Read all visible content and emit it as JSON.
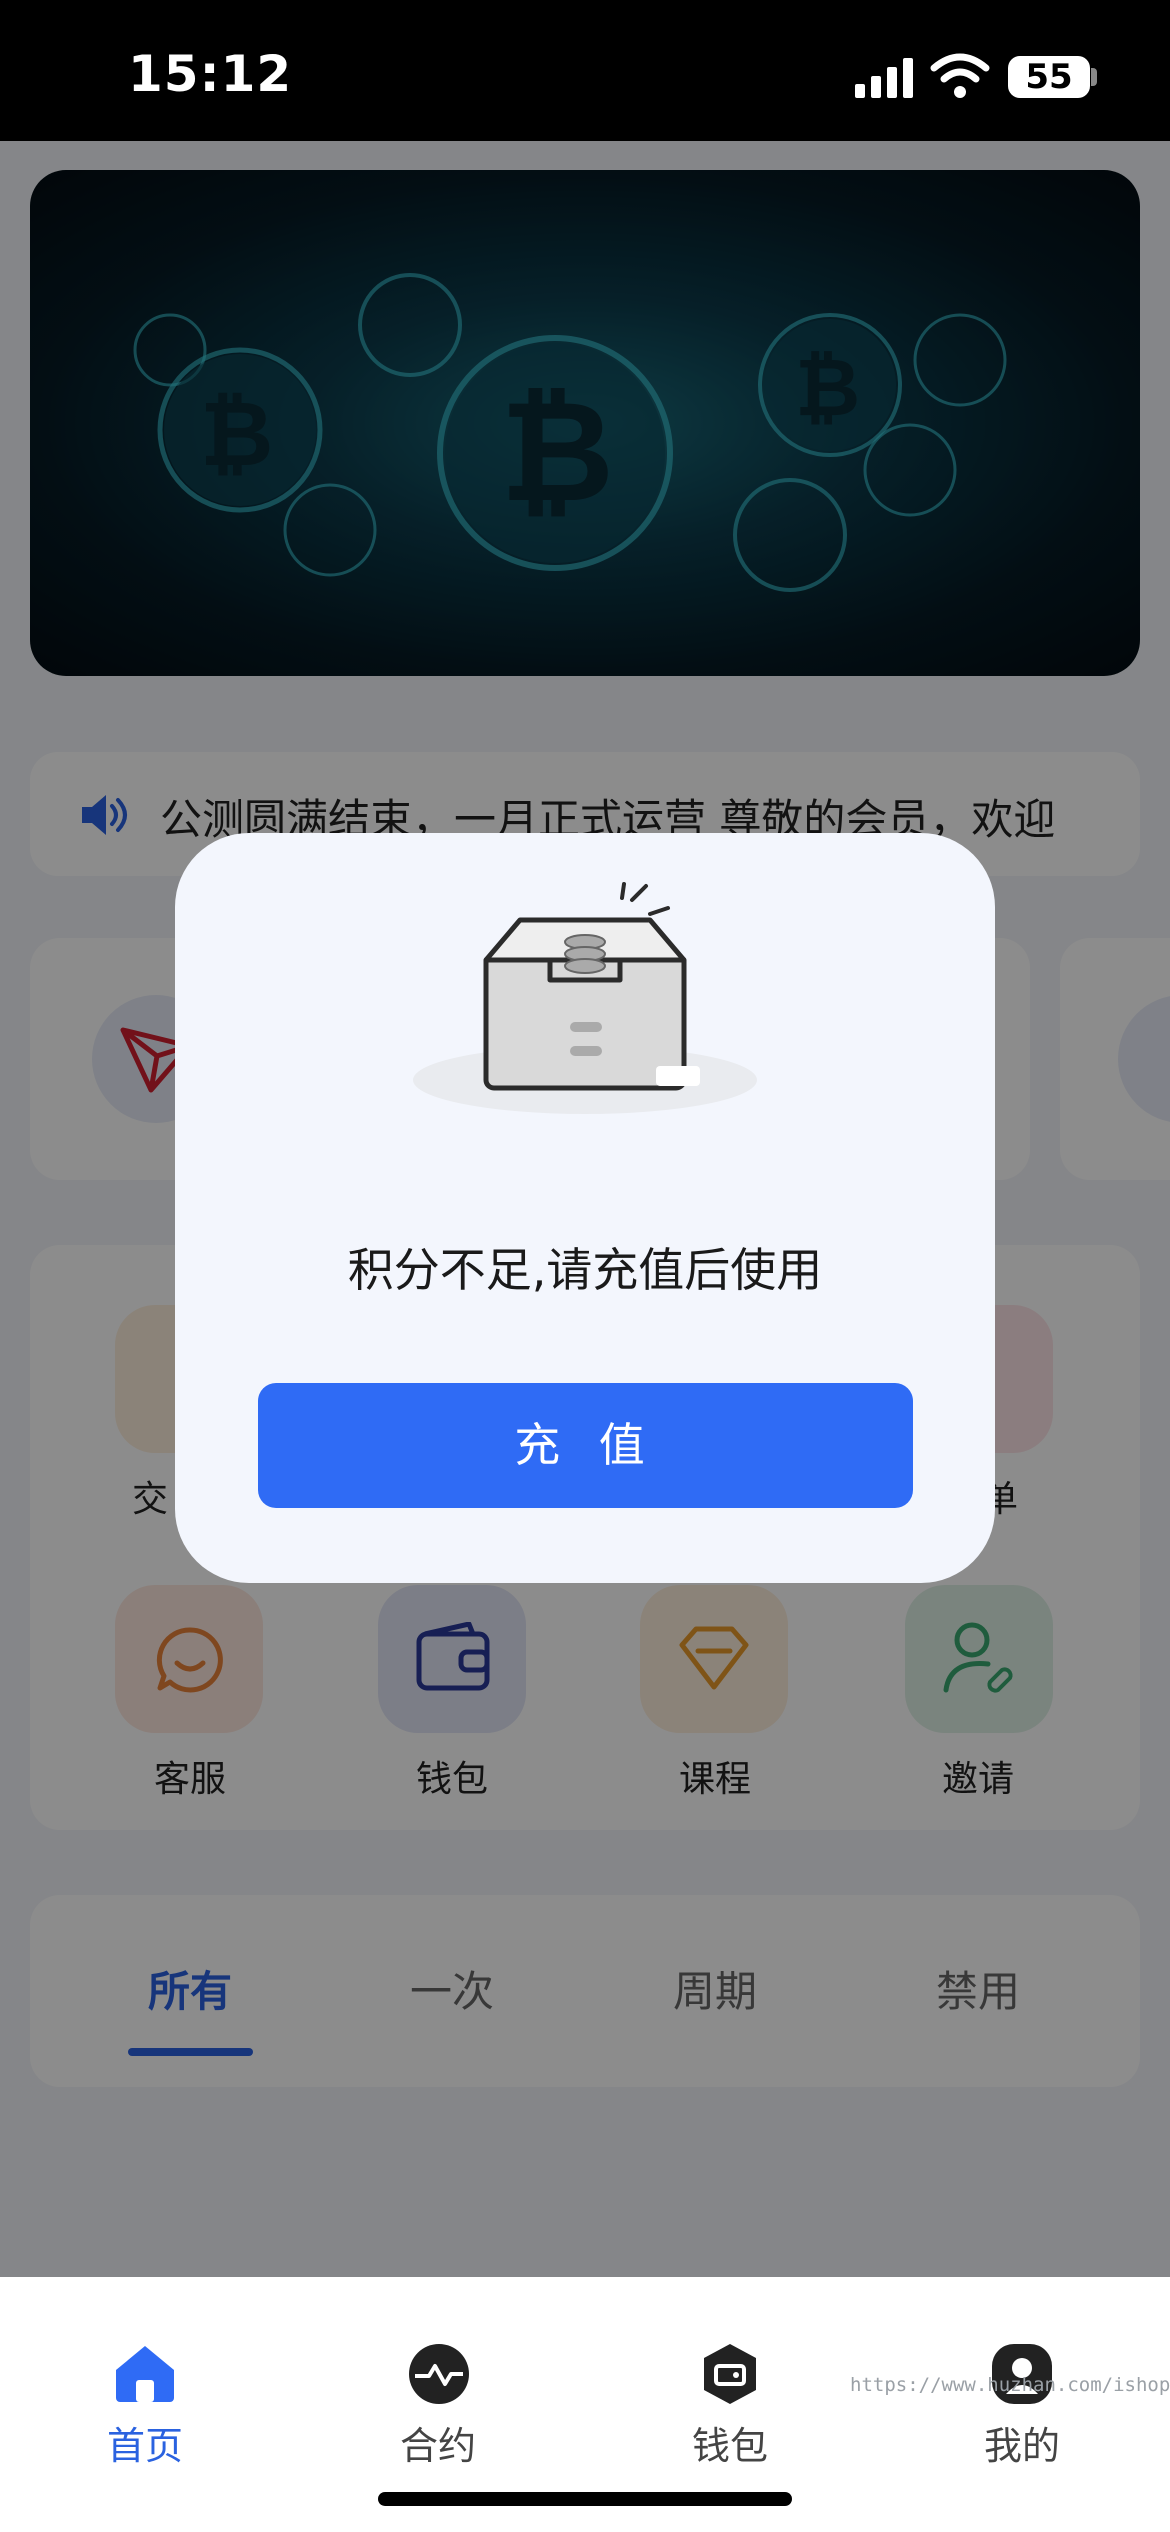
{
  "status_bar": {
    "time": "15:12",
    "battery": "55"
  },
  "notice": {
    "text": "公测圆满结束，一月正式运营 尊敬的会员，欢迎"
  },
  "grid": {
    "row1": [
      {
        "label": "交"
      },
      {
        "label": "单"
      }
    ],
    "row2": [
      {
        "label": "客服",
        "icon": "chat-icon",
        "color": "#e8823a"
      },
      {
        "label": "钱包",
        "icon": "wallet-icon",
        "color": "#2a3a9a"
      },
      {
        "label": "课程",
        "icon": "diamond-icon",
        "color": "#e89a2a"
      },
      {
        "label": "邀请",
        "icon": "invite-user-icon",
        "color": "#3aa870"
      }
    ]
  },
  "tabs": [
    "所有",
    "一次",
    "周期",
    "禁用"
  ],
  "bottom_nav": [
    {
      "label": "首页",
      "icon": "home-icon",
      "active": true
    },
    {
      "label": "合约",
      "icon": "contract-icon",
      "active": false
    },
    {
      "label": "钱包",
      "icon": "wallet-icon",
      "active": false
    },
    {
      "label": "我的",
      "icon": "profile-icon",
      "active": false
    }
  ],
  "watermark": "https://www.huzhan.com/ishop45801",
  "dialog": {
    "message": "积分不足,请充值后使用",
    "button_label": "充 值",
    "illustration": "empty-inbox-icon"
  },
  "colors": {
    "accent": "#2f6bf5",
    "overlay": "rgba(0,0,0,0.45)"
  }
}
